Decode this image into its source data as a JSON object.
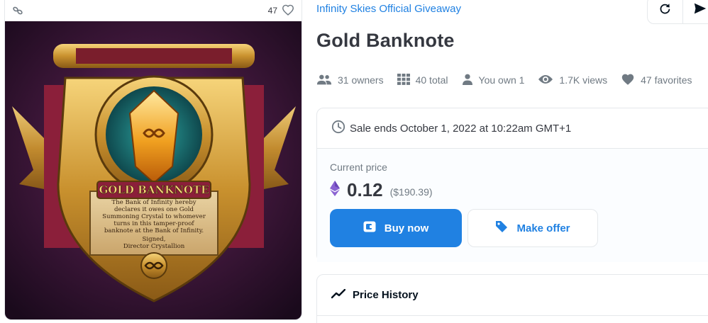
{
  "asset": {
    "favorites_count": "47",
    "image_text": {
      "banner": "GOLD BANKNOTE",
      "inscription": [
        "The Bank of Infinity hereby",
        "declares it owes one Gold",
        "Summoning Crystal to whomever",
        "turns in this tamper-proof",
        "banknote at the Bank of Infinity.",
        "Signed,",
        "Director Crystallion"
      ]
    }
  },
  "collection": {
    "name": "Infinity Skies Official Giveaway"
  },
  "item": {
    "title": "Gold Banknote"
  },
  "actions": {
    "refresh_icon": "refresh-icon",
    "share_icon": "send-icon"
  },
  "stats": {
    "owners": "31 owners",
    "total": "40 total",
    "you_own": "You own 1",
    "views": "1.7K views",
    "favorites": "47 favorites"
  },
  "sale": {
    "ends_text": "Sale ends October 1, 2022 at 10:22am GMT+1",
    "current_price_label": "Current price",
    "price": "0.12",
    "price_usd": "($190.39)",
    "buy_label": "Buy now",
    "offer_label": "Make offer"
  },
  "history": {
    "title": "Price History"
  },
  "colors": {
    "accent": "#2081e2",
    "text": "#353840",
    "muted": "#707a83",
    "border": "#e5e8eb"
  }
}
